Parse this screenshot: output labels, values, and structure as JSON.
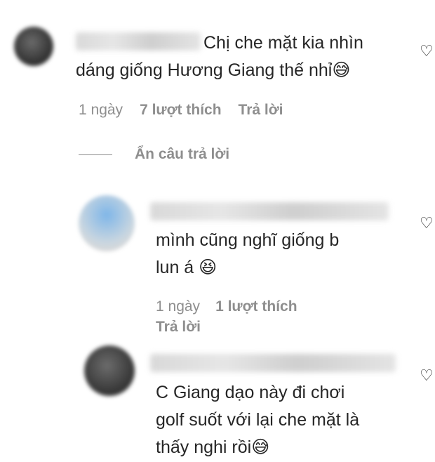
{
  "comments": [
    {
      "text": "Chị che mặt kia nhìn\ndáng giống Hương Giang thế nhỉ😅",
      "time": "1 ngày",
      "likes": "7 lượt thích",
      "reply": "Trả lời"
    },
    {
      "text": "mình cũng nghĩ giống b\nlun á 😆",
      "time": "1 ngày",
      "likes": "1 lượt thích",
      "reply": "Trả lời"
    },
    {
      "text": "C Giang dạo này đi chơi\ngolf suốt với lại che mặt là\nthấy nghi rồi😅"
    }
  ],
  "hide_replies_label": "Ẩn câu trả lời",
  "icons": {
    "like": "heart-outline-icon"
  }
}
